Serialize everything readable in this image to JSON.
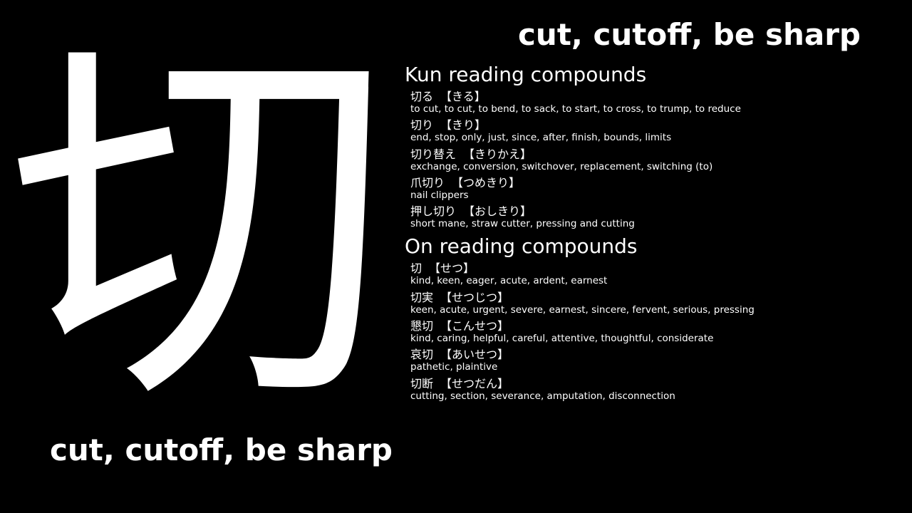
{
  "kanji": "切",
  "meaning": "cut, cutoff, be sharp",
  "sections": [
    {
      "title": "Kun reading compounds",
      "entries": [
        {
          "word": "切る",
          "reading": "【きる】",
          "gloss": "to cut, to cut, to bend, to sack, to start, to cross, to trump, to reduce"
        },
        {
          "word": "切り",
          "reading": "【きり】",
          "gloss": "end, stop, only, just, since, after, finish, bounds, limits"
        },
        {
          "word": "切り替え",
          "reading": "【きりかえ】",
          "gloss": "exchange, conversion, switchover, replacement, switching (to)"
        },
        {
          "word": "爪切り",
          "reading": "【つめきり】",
          "gloss": "nail clippers"
        },
        {
          "word": "押し切り",
          "reading": "【おしきり】",
          "gloss": "short mane, straw cutter, pressing and cutting"
        }
      ]
    },
    {
      "title": "On reading compounds",
      "entries": [
        {
          "word": "切",
          "reading": "【せつ】",
          "gloss": "kind, keen, eager, acute, ardent, earnest"
        },
        {
          "word": "切実",
          "reading": "【せつじつ】",
          "gloss": "keen, acute, urgent, severe, earnest, sincere, fervent, serious, pressing"
        },
        {
          "word": "懇切",
          "reading": "【こんせつ】",
          "gloss": "kind, caring, helpful, careful, attentive, thoughtful, considerate"
        },
        {
          "word": "哀切",
          "reading": "【あいせつ】",
          "gloss": "pathetic, plaintive"
        },
        {
          "word": "切断",
          "reading": "【せつだん】",
          "gloss": "cutting, section, severance, amputation, disconnection"
        }
      ]
    }
  ]
}
